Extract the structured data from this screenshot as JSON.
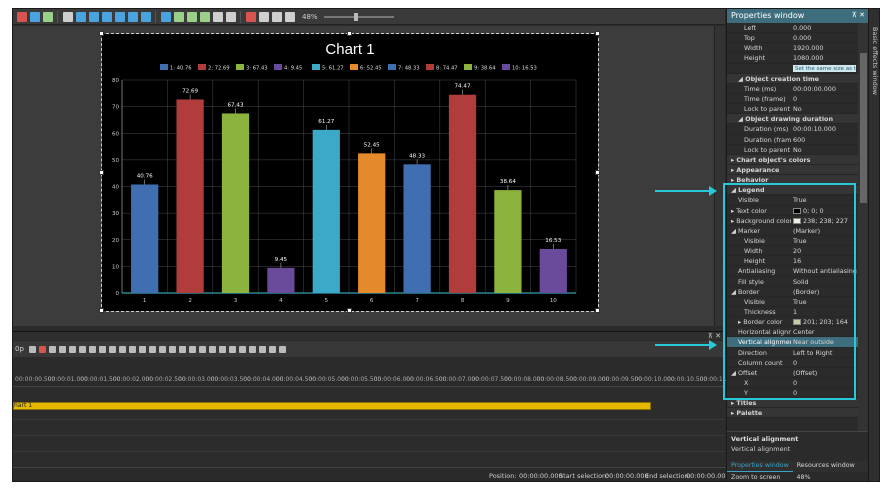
{
  "toolbar": {
    "zoom": "48%",
    "icon_colors": [
      "#d9534f",
      "#4aa3df",
      "#9bd08b",
      "#cfcfcf",
      "#4aa3df",
      "#4aa3df",
      "#4aa3df",
      "#4aa3df",
      "#4aa3df",
      "#4aa3df",
      "#4aa3df",
      "#9bd08b",
      "#9bd08b",
      "#9bd08b",
      "#cfcfcf",
      "#cfcfcf",
      "#d9534f",
      "#cfcfcf",
      "#cfcfcf",
      "#cfcfcf"
    ]
  },
  "chart_data": {
    "type": "bar",
    "title": "Chart 1",
    "categories": [
      "1",
      "2",
      "3",
      "4",
      "5",
      "6",
      "7",
      "8",
      "9",
      "10"
    ],
    "values": [
      40.76,
      72.69,
      67.43,
      9.45,
      61.27,
      52.45,
      48.33,
      74.47,
      38.64,
      16.53
    ],
    "value_labels": [
      "40.76",
      "72.69",
      "67.43",
      "9.45",
      "61.27",
      "52.45",
      "48.33",
      "74.47",
      "38.64",
      "16.53"
    ],
    "legend": [
      "1: 40.76",
      "2: 72.69",
      "3: 67.43",
      "4: 9.45",
      "5: 61.27",
      "6: 52.45",
      "7: 48.33",
      "8: 74.47",
      "9: 38.64",
      "10: 16.53"
    ],
    "colors": [
      "#3f6fb0",
      "#b03c3c",
      "#8db33f",
      "#6a4a9a",
      "#3da9c9",
      "#e58a2a",
      "#3f6fb0",
      "#b03c3c",
      "#8db33f",
      "#6a4a9a"
    ],
    "y_ticks": [
      "0",
      "10",
      "20",
      "30",
      "40",
      "50",
      "60",
      "70",
      "80"
    ],
    "ylim": [
      0,
      80
    ],
    "legend_position": "top",
    "grid": true
  },
  "timeline": {
    "ruler": [
      "00:00:00.500",
      "00:00:01.000",
      "00:00:01.500",
      "00:00:02.000",
      "00:00:02.500",
      "00:00:03.000",
      "00:00:03.500",
      "00:00:04.000",
      "00:00:04.500",
      "00:00:05.000",
      "00:00:05.500",
      "00:00:06.000",
      "00:00:06.500",
      "00:00:07.000",
      "00:00:07.500",
      "00:00:08.000",
      "00:00:08.500",
      "00:00:09.000",
      "00:00:09.500",
      "00:00:10.000",
      "00:00:10.500",
      "00:00:11.000"
    ],
    "track_label": "hart 1",
    "left_value": "0p"
  },
  "status": {
    "position_label": "Position:",
    "position_value": "00:00:00.000",
    "start_label": "Start selection:",
    "start_value": "00:00:00.000",
    "end_label": "End selection:",
    "end_value": "00:00:00.000"
  },
  "props": {
    "title": "Properties window",
    "pin": "⊼ ✕",
    "rows": [
      {
        "k": "Left",
        "v": "0.000",
        "lvl": 2
      },
      {
        "k": "Top",
        "v": "0.000",
        "lvl": 2
      },
      {
        "k": "Width",
        "v": "1920.000",
        "lvl": 2
      },
      {
        "k": "Height",
        "v": "1080.000",
        "lvl": 2
      },
      {
        "k": "",
        "v": "Set the same size as the parent frame",
        "lvl": 2,
        "btn": true
      },
      {
        "k": "◢ Object creation time",
        "v": "",
        "lvl": 1,
        "sec": true
      },
      {
        "k": "Time (ms)",
        "v": "00:00:00.000",
        "lvl": 2
      },
      {
        "k": "Time (frame)",
        "v": "0",
        "lvl": 2
      },
      {
        "k": "Lock to parent duration",
        "v": "No",
        "lvl": 2
      },
      {
        "k": "◢ Object drawing duration",
        "v": "",
        "lvl": 1,
        "sec": true
      },
      {
        "k": "Duration (ms)",
        "v": "00:00:10.000",
        "lvl": 2
      },
      {
        "k": "Duration (frames)",
        "v": "600",
        "lvl": 2
      },
      {
        "k": "Lock to parent duration",
        "v": "No",
        "lvl": 2
      },
      {
        "k": "▸ Chart object's colors",
        "v": "",
        "lvl": 0,
        "sec": true
      },
      {
        "k": "▸ Appearance",
        "v": "",
        "lvl": 0,
        "sec": true
      },
      {
        "k": "▸ Behavior",
        "v": "",
        "lvl": 0,
        "sec": true
      },
      {
        "k": "◢ Legend",
        "v": "",
        "lvl": 0,
        "sec": true
      },
      {
        "k": "Visible",
        "v": "True",
        "lvl": 1
      },
      {
        "k": "▸ Text color",
        "v": "0; 0; 0",
        "lvl": 0,
        "sw": "#000000"
      },
      {
        "k": "▸ Background color",
        "v": "238; 238; 227",
        "lvl": 0,
        "sw": "#eeeee3"
      },
      {
        "k": "◢ Marker",
        "v": "(Marker)",
        "lvl": 0
      },
      {
        "k": "Visible",
        "v": "True",
        "lvl": 2
      },
      {
        "k": "Width",
        "v": "20",
        "lvl": 2
      },
      {
        "k": "Height",
        "v": "16",
        "lvl": 2
      },
      {
        "k": "Antialiasing",
        "v": "Without antialiasing",
        "lvl": 1
      },
      {
        "k": "Fill style",
        "v": "Solid",
        "lvl": 1
      },
      {
        "k": "◢ Border",
        "v": "(Border)",
        "lvl": 0
      },
      {
        "k": "Visible",
        "v": "True",
        "lvl": 2
      },
      {
        "k": "Thickness",
        "v": "1",
        "lvl": 2
      },
      {
        "k": "▸ Border color",
        "v": "201; 203; 164",
        "lvl": 1,
        "sw": "#c9cba4"
      },
      {
        "k": "Horizontal alignment",
        "v": "Center",
        "lvl": 1
      },
      {
        "k": "Vertical alignment",
        "v": "Near outside",
        "lvl": 1,
        "hl": true
      },
      {
        "k": "Direction",
        "v": "Left to Right",
        "lvl": 1
      },
      {
        "k": "Column count",
        "v": "0",
        "lvl": 1
      },
      {
        "k": "◢ Offset",
        "v": "(Offset)",
        "lvl": 0
      },
      {
        "k": "X",
        "v": "0",
        "lvl": 2
      },
      {
        "k": "Y",
        "v": "0",
        "lvl": 2
      },
      {
        "k": "▸ Titles",
        "v": "",
        "lvl": 0,
        "sec": true
      },
      {
        "k": "▸ Palette",
        "v": "",
        "lvl": 0,
        "sec": true
      }
    ],
    "desc_title": "Vertical alignment",
    "desc_text": "Vertical alignment",
    "tab_active": "Properties window",
    "tab_other": "Resources window",
    "zoom_label": "Zoom to screen",
    "zoom_value": "48%"
  },
  "side_tab": "Basic effects window"
}
